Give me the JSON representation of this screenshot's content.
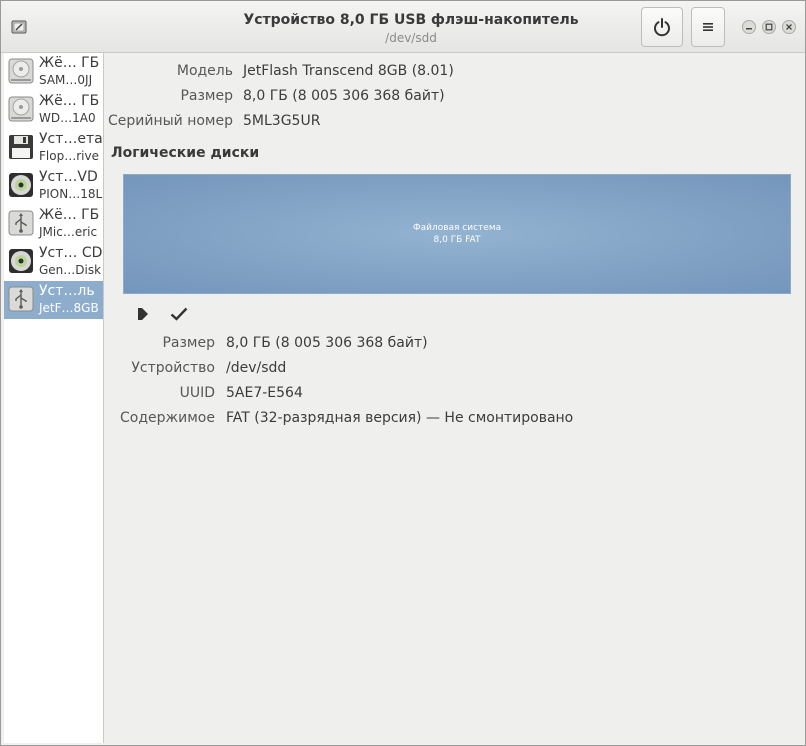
{
  "window": {
    "title": "Устройство 8,0 ГБ USB флэш-накопитель",
    "subtitle": "/dev/sdd"
  },
  "drives": [
    {
      "name": "Жё… ГБ",
      "model": "SAM…0JJ",
      "icon": "hard-disk-icon"
    },
    {
      "name": "Жё… ГБ",
      "model": "WD…1A0",
      "icon": "hard-disk-icon"
    },
    {
      "name": "Уст…ета",
      "model": "Flop…rive",
      "icon": "floppy-icon"
    },
    {
      "name": "Уст…VD",
      "model": "PION…18L",
      "icon": "optical-disc-icon"
    },
    {
      "name": "Жё… ГБ",
      "model": "JMic…eric",
      "icon": "usb-drive-icon"
    },
    {
      "name": "Уст… CD",
      "model": "Gen…Disk",
      "icon": "optical-disc-icon"
    },
    {
      "name": "Уст…ль",
      "model": "JetF…8GB",
      "icon": "usb-drive-icon",
      "selected": true
    }
  ],
  "device": {
    "model_label": "Модель",
    "model_value": "JetFlash Transcend 8GB (8.01)",
    "size_label": "Размер",
    "size_value": "8,0 ГБ (8 005 306 368 байт)",
    "serial_label": "Серийный номер",
    "serial_value": "5ML3G5UR"
  },
  "volumes": {
    "heading": "Логические диски",
    "partition_name": "Файловая система",
    "partition_info": "8,0 ГБ FAT"
  },
  "partition": {
    "size_label": "Размер",
    "size_value": "8,0 ГБ (8 005 306 368 байт)",
    "device_label": "Устройство",
    "device_value": "/dev/sdd",
    "uuid_label": "UUID",
    "uuid_value": "5AE7-E564",
    "contents_label": "Содержимое",
    "contents_value": "FAT (32-разрядная версия) — Не смонтировано"
  },
  "colors": {
    "selection": "#8eadcc",
    "partition": "#7d9ec1"
  }
}
